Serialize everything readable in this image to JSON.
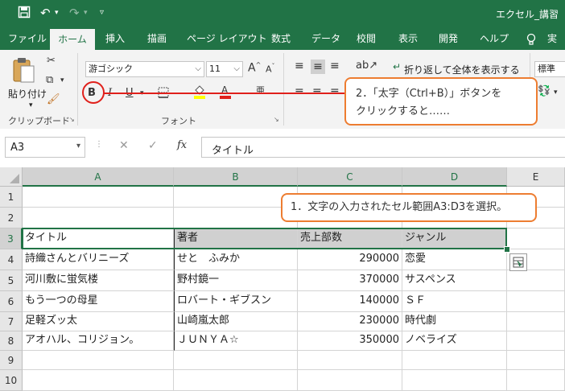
{
  "app": {
    "title": "エクセル_講習"
  },
  "tabs": [
    "ファイル",
    "ホーム",
    "挿入",
    "描画",
    "ページ レイアウト",
    "数式",
    "データ",
    "校閲",
    "表示",
    "開発",
    "ヘルプ",
    "実行"
  ],
  "ribbon": {
    "paste_label": "貼り付け",
    "clipboard_label": "クリップボード",
    "font_name": "游ゴシック",
    "font_size": "11",
    "grow_font": "A",
    "shrink_font": "A",
    "bold": "B",
    "italic": "I",
    "underline": "U",
    "font_group_label": "フォント",
    "wrap_text": "折り返して全体を表示する",
    "number_format": "標準"
  },
  "formula_bar": {
    "name_box": "A3",
    "fx": "fx",
    "content": "タイトル"
  },
  "columns": [
    "A",
    "B",
    "C",
    "D",
    "E"
  ],
  "rows": [
    "1",
    "2",
    "3",
    "4",
    "5",
    "6",
    "7",
    "8",
    "9",
    "10"
  ],
  "table": [
    [
      "タイトル",
      "著者",
      "売上部数",
      "ジャンル"
    ],
    [
      "詩織さんとバリニーズ",
      "せと　ふみか",
      "290000",
      "恋愛"
    ],
    [
      "河川敷に蛍気楼",
      "野村鏡一",
      "370000",
      "サスペンス"
    ],
    [
      "もう一つの母星",
      "ロバート・ギブスン",
      "140000",
      "ＳＦ"
    ],
    [
      "足軽ズッ太",
      "山崎嵐太郎",
      "230000",
      "時代劇"
    ],
    [
      "アオハル、コリジョン。",
      "ＪＵＮＹＡ☆",
      "350000",
      "ノベライズ"
    ]
  ],
  "callouts": {
    "step1": "1．文字の入力されたセル範囲A3:D3を選択。",
    "step2_line1": "2．「太字（Ctrl+B）」ボタンを",
    "step2_line2": "クリックすると……"
  },
  "colors": {
    "excel_green": "#217346",
    "accent_orange": "#ed7d31",
    "highlight_red": "#e0201b"
  }
}
